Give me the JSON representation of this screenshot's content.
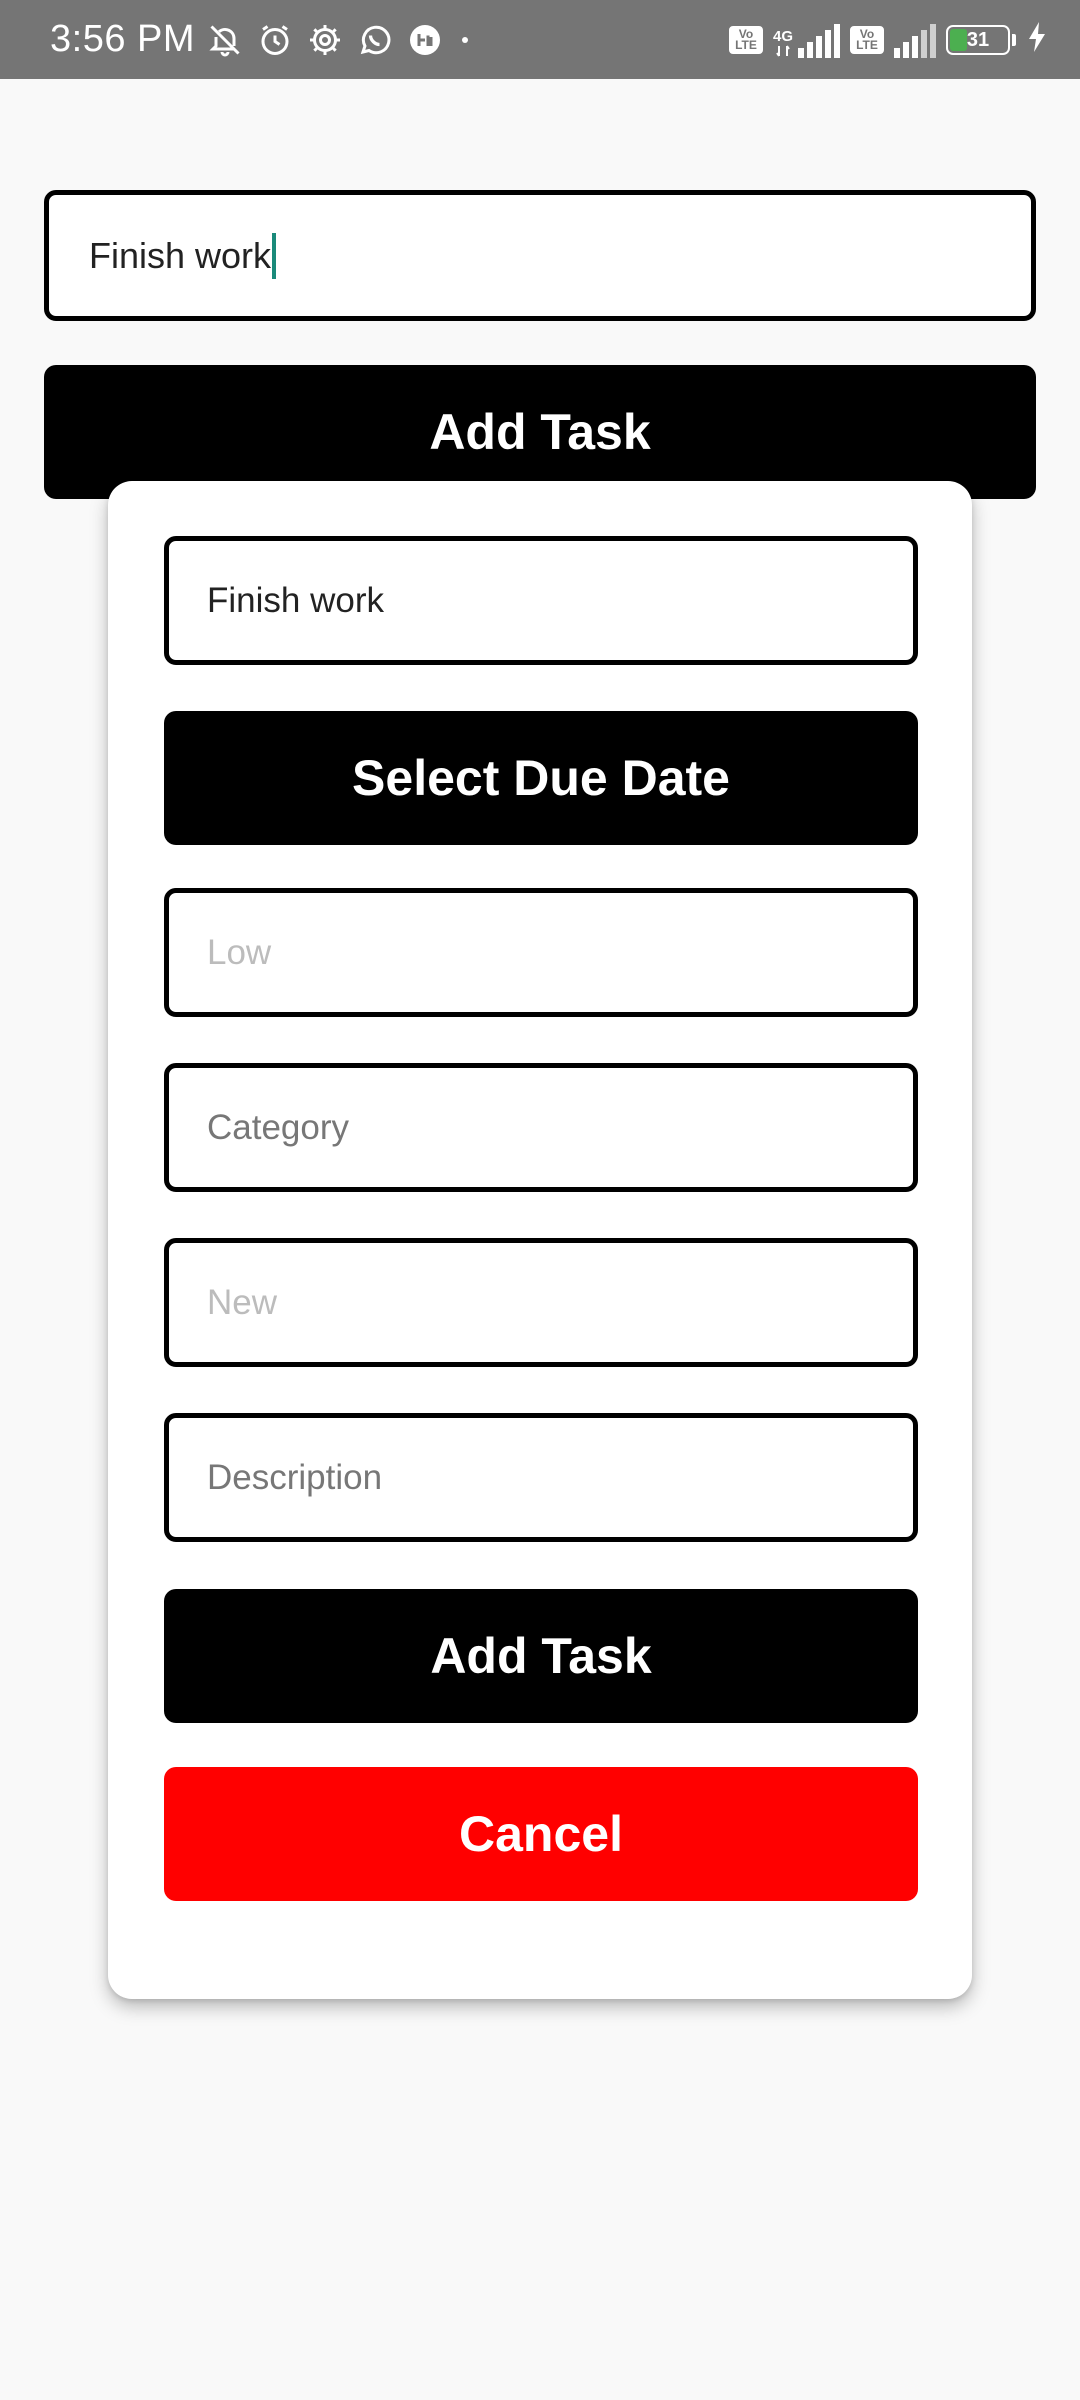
{
  "status_bar": {
    "time": "3:56 PM",
    "network_label": "4G",
    "volte_label": "Vo LTE",
    "battery_level": "31",
    "battery_fill_color": "#4caf50",
    "icons": [
      "mute-bell-icon",
      "alarm-icon",
      "settings-gear-icon",
      "whatsapp-icon",
      "app-notification-icon",
      "dot-icon",
      "volte-icon",
      "signal-icon",
      "battery-icon",
      "charging-bolt-icon"
    ]
  },
  "main": {
    "task_input_value": "Finish work",
    "add_task_label": "Add Task"
  },
  "modal": {
    "task_name_value": "Finish work",
    "select_due_date_label": "Select Due Date",
    "priority_placeholder": "Low",
    "category_placeholder": "Category",
    "status_placeholder": "New",
    "description_placeholder": "Description",
    "add_task_label": "Add Task",
    "cancel_label": "Cancel"
  },
  "colors": {
    "status_bar_bg": "#757575",
    "button_primary": "#000000",
    "button_cancel": "#ff0000",
    "caret": "#1a8a7a",
    "page_bg": "#f9f9f9"
  }
}
